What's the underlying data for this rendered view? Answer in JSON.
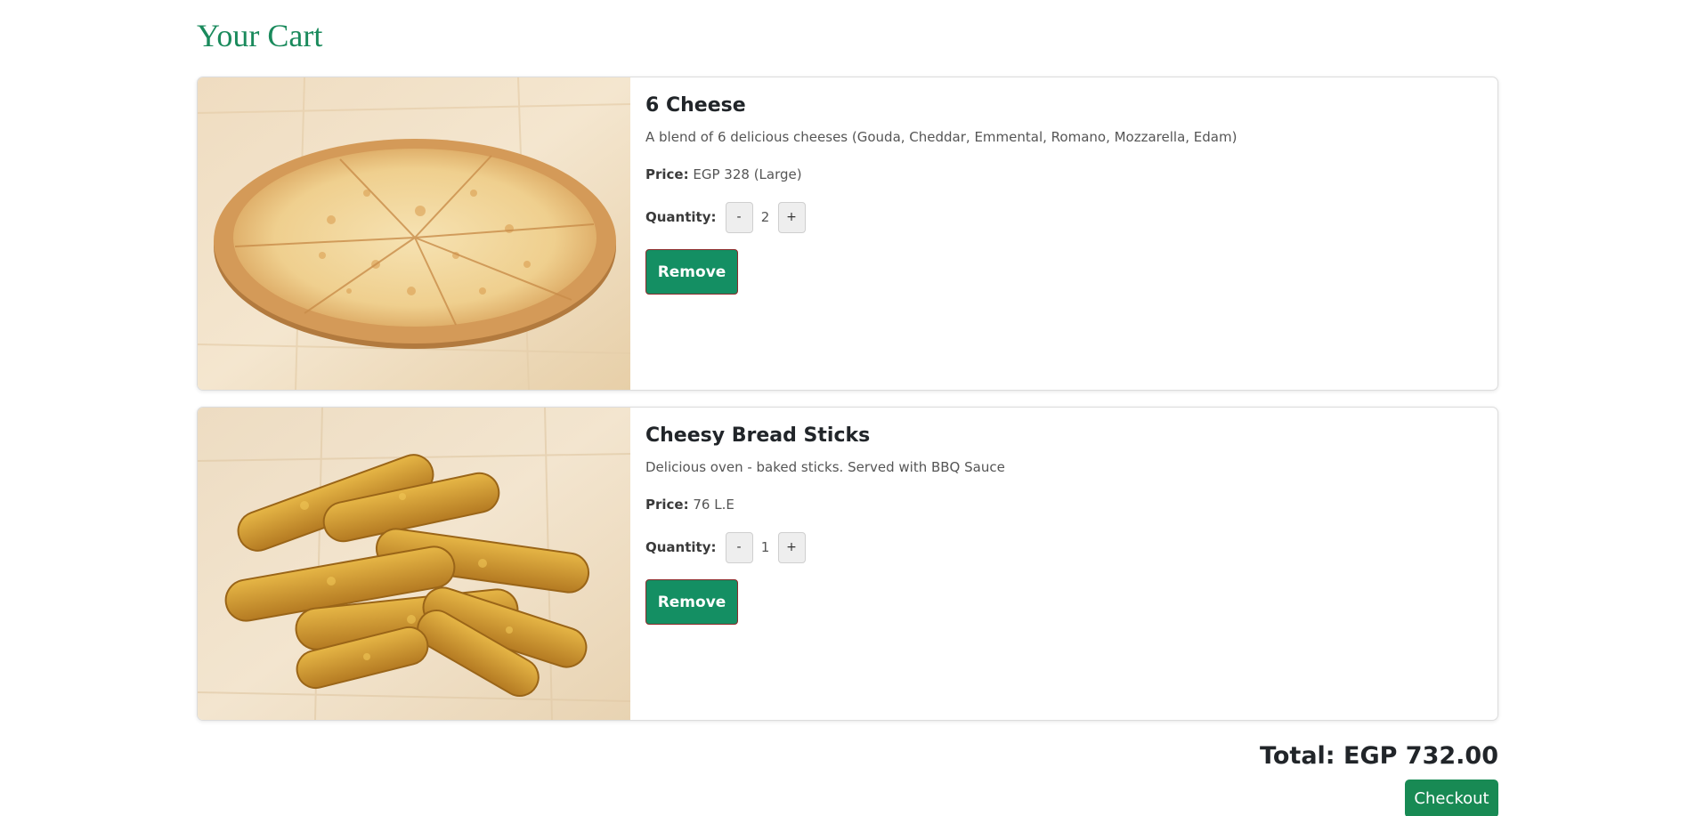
{
  "page": {
    "title": "Your Cart"
  },
  "cart": {
    "items": [
      {
        "name": "6 Cheese",
        "description": "A blend of 6 delicious cheeses (Gouda, Cheddar, Emmental, Romano, Mozzarella, Edam)",
        "price_label": "Price:",
        "price": "EGP 328 (Large)",
        "quantity_label": "Quantity:",
        "quantity": "2",
        "decrement_label": "-",
        "increment_label": "+",
        "remove_label": "Remove",
        "image_icon": "pizza-image"
      },
      {
        "name": "Cheesy Bread Sticks",
        "description": "Delicious oven - baked sticks. Served with BBQ Sauce",
        "price_label": "Price:",
        "price": "76 L.E",
        "quantity_label": "Quantity:",
        "quantity": "1",
        "decrement_label": "-",
        "increment_label": "+",
        "remove_label": "Remove",
        "image_icon": "bread-sticks-image"
      }
    ]
  },
  "summary": {
    "total": "Total: EGP 732.00",
    "checkout_label": "Checkout"
  },
  "colors": {
    "accent": "#148f63",
    "title": "#1a8a5c",
    "checkout": "#188a54"
  }
}
